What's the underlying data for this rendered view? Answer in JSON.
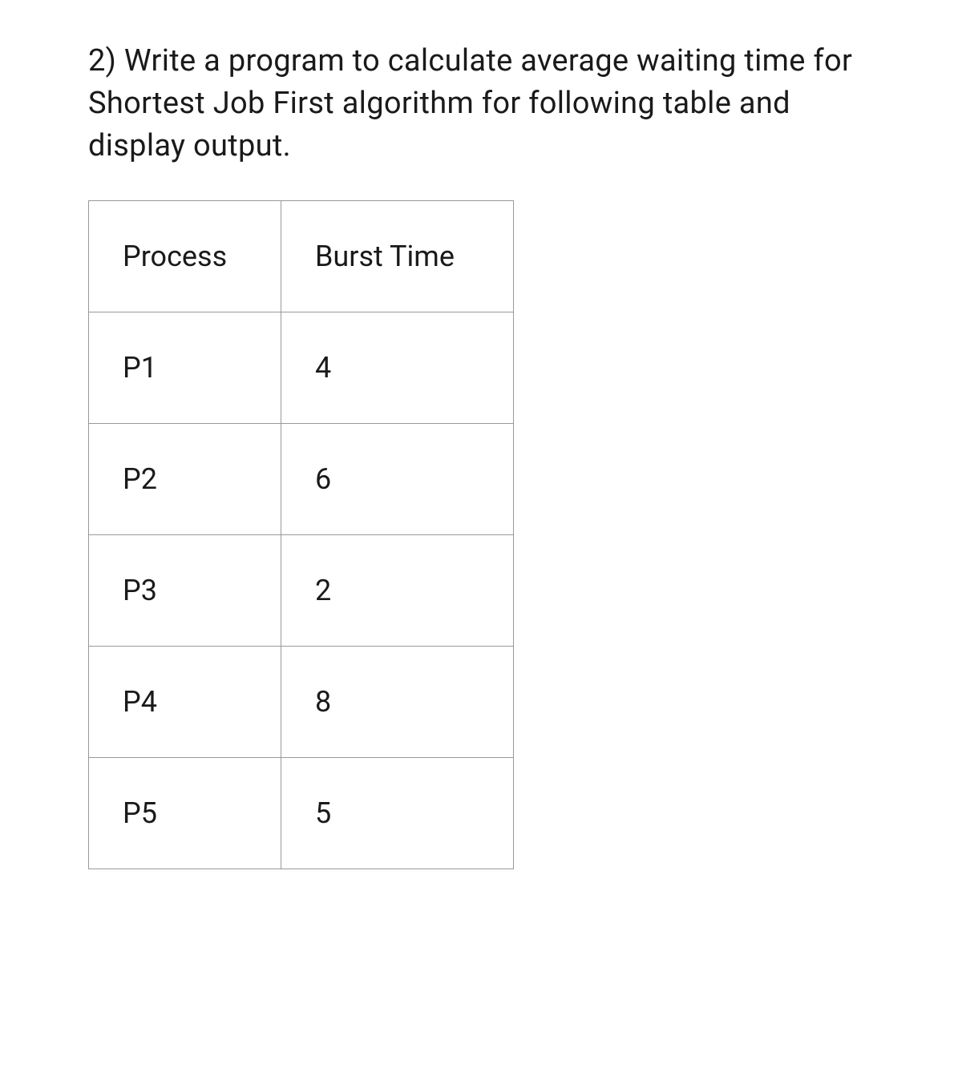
{
  "question": {
    "text": "2) Write a program to calculate average waiting time for Shortest Job First algorithm for following table and display output."
  },
  "table": {
    "headers": {
      "process": "Process",
      "burst": "Burst Time"
    },
    "rows": [
      {
        "process": "P1",
        "burst": "4"
      },
      {
        "process": "P2",
        "burst": "6"
      },
      {
        "process": "P3",
        "burst": "2"
      },
      {
        "process": "P4",
        "burst": "8"
      },
      {
        "process": "P5",
        "burst": "5"
      }
    ]
  }
}
